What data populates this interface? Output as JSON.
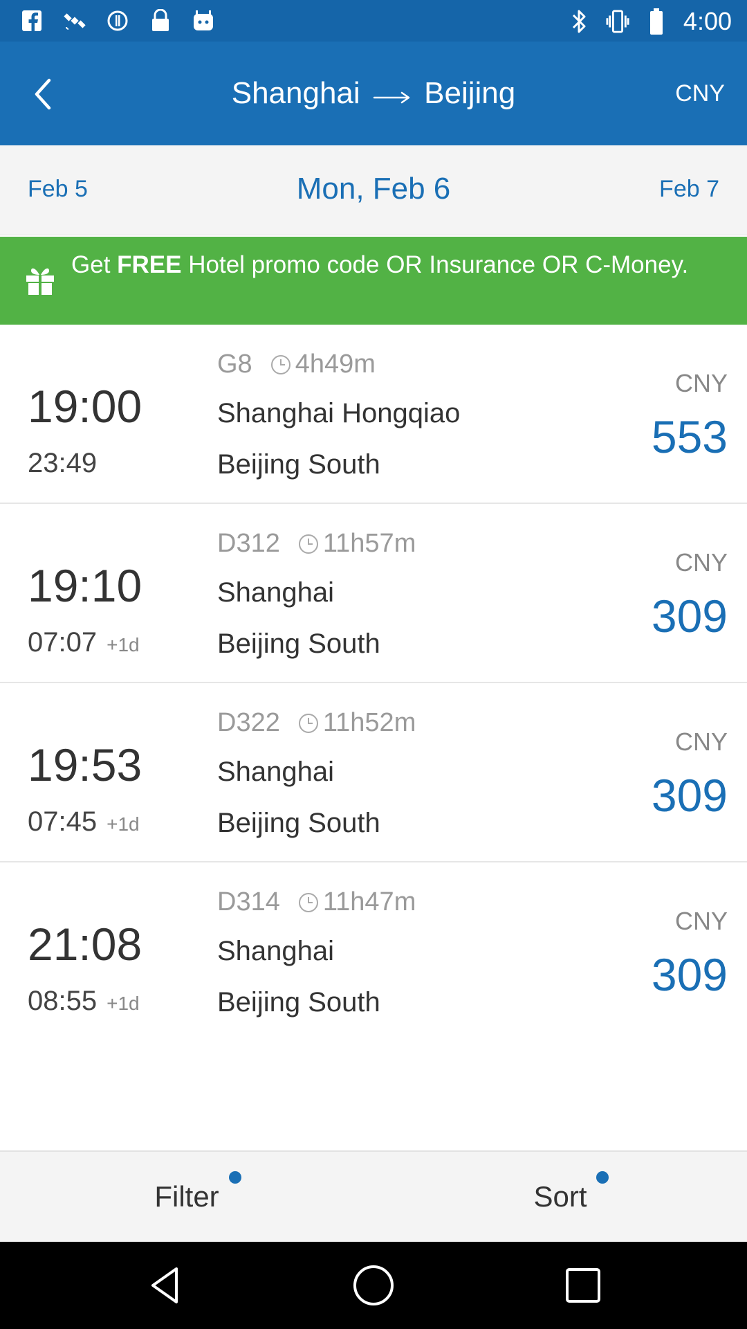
{
  "status_bar": {
    "time": "4:00",
    "left_icons": [
      "facebook-icon",
      "satellite-icon",
      "alarm-icon",
      "lock-icon",
      "robot-icon"
    ],
    "right_icons": [
      "bluetooth-icon",
      "vibrate-icon",
      "battery-icon"
    ]
  },
  "header": {
    "from": "Shanghai",
    "to": "Beijing",
    "currency": "CNY"
  },
  "dates": {
    "prev": "Feb 5",
    "current": "Mon, Feb 6",
    "next": "Feb 7"
  },
  "promo": {
    "prefix": "Get ",
    "highlight": "FREE",
    "suffix": " Hotel promo code OR Insurance OR C-Money."
  },
  "trains": [
    {
      "departure": "19:00",
      "arrival": "23:49",
      "day_offset": "",
      "train_no": "G8",
      "duration": "4h49m",
      "from_station": "Shanghai Hongqiao",
      "to_station": "Beijing South",
      "currency": "CNY",
      "price": "553"
    },
    {
      "departure": "19:10",
      "arrival": "07:07",
      "day_offset": "+1d",
      "train_no": "D312",
      "duration": "11h57m",
      "from_station": "Shanghai",
      "to_station": "Beijing South",
      "currency": "CNY",
      "price": "309"
    },
    {
      "departure": "19:53",
      "arrival": "07:45",
      "day_offset": "+1d",
      "train_no": "D322",
      "duration": "11h52m",
      "from_station": "Shanghai",
      "to_station": "Beijing South",
      "currency": "CNY",
      "price": "309"
    },
    {
      "departure": "21:08",
      "arrival": "08:55",
      "day_offset": "+1d",
      "train_no": "D314",
      "duration": "11h47m",
      "from_station": "Shanghai",
      "to_station": "Beijing South",
      "currency": "CNY",
      "price": "309"
    }
  ],
  "bottom_bar": {
    "filter": "Filter",
    "sort": "Sort"
  },
  "colors": {
    "primary": "#1a6fb5",
    "status_bar": "#1565a9",
    "promo": "#52b245",
    "price": "#1a6fb5"
  }
}
